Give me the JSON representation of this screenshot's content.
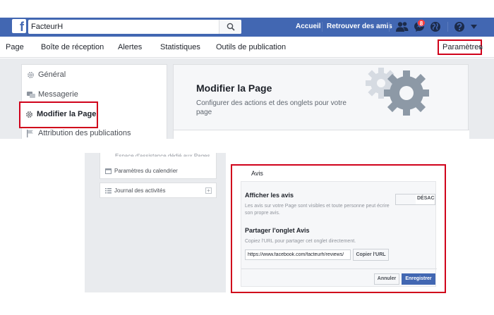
{
  "topbar": {
    "logo": "f",
    "search_value": "FacteurH",
    "links": [
      "Accueil",
      "Retrouver des amis"
    ],
    "notification_count": "8",
    "icons": [
      "friends-icon",
      "messenger-icon",
      "globe-icon",
      "help-icon",
      "caret-icon"
    ],
    "color": "#4267b2"
  },
  "pagenav": {
    "items": [
      "Page",
      "Boîte de réception",
      "Alertes",
      "Statistiques",
      "Outils de publication"
    ],
    "settings": "Paramètres"
  },
  "settings_menu": {
    "items": [
      "Général",
      "Messagerie",
      "Modifier la Page",
      "Attribution des publications"
    ]
  },
  "edit_page": {
    "title": "Modifier la Page",
    "subtitle": "Configurer des actions et des onglets pour votre page"
  },
  "sidebar_lower": {
    "cut_item": "Espace d'assistance dédié aux Pages",
    "items": [
      "Paramètres du calendrier",
      "Journal des activités"
    ]
  },
  "reviews": {
    "heading": "Avis",
    "show_label": "Afficher les avis",
    "show_desc": "Les avis sur votre Page sont visibles et toute personne peut écrire son propre avis.",
    "toggle_state": "DÉSAC",
    "share_label": "Partager l'onglet Avis",
    "share_desc": "Copiez l'URL pour partager cet onglet directement.",
    "url_value": "https://www.facebook.com/facteurh/reviews/",
    "copy_button": "Copier l'URL",
    "cancel_button": "Annuler",
    "save_button": "Enregistrer"
  },
  "colors": {
    "highlight": "#d0021b",
    "primary": "#4267b2",
    "background": "#e9ebee"
  }
}
